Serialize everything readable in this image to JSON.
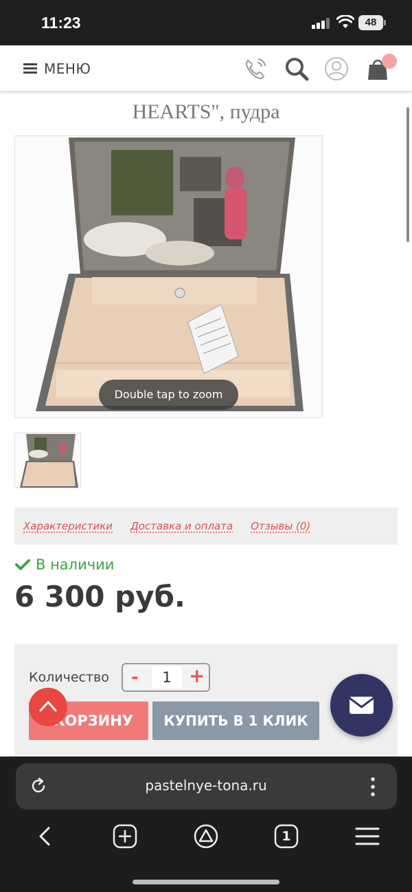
{
  "status_bar": {
    "time": "11:23",
    "battery": "48"
  },
  "header": {
    "menu_label": "МЕНЮ",
    "icons": [
      "phone-icon",
      "search-icon",
      "user-icon",
      "cart-icon"
    ]
  },
  "product": {
    "title": "HEARTS\", пудра",
    "zoom_hint": "Double tap to zoom",
    "tabs": [
      "Характеристики",
      "Доставка и оплата",
      "Отзывы (0)"
    ],
    "stock": "В наличии",
    "price": "6 300 руб."
  },
  "buy_box": {
    "quantity_label": "Количество",
    "quantity_value": "1",
    "minus": "-",
    "plus": "+",
    "cart_button": "КОРЗИНУ",
    "one_click_button": "КУПИТЬ В 1 КЛИК"
  },
  "browser": {
    "url": "pastelnye-tona.ru",
    "nav_icons": [
      "back-icon",
      "new-tab-icon",
      "home-icon",
      "tabs-icon",
      "menu-icon"
    ],
    "tab_count": "1"
  },
  "colors": {
    "accent": "#f07a78",
    "link": "#e05050",
    "in_stock": "#3aa541",
    "secondary_button": "#8b98a6",
    "fab": "#323463"
  }
}
